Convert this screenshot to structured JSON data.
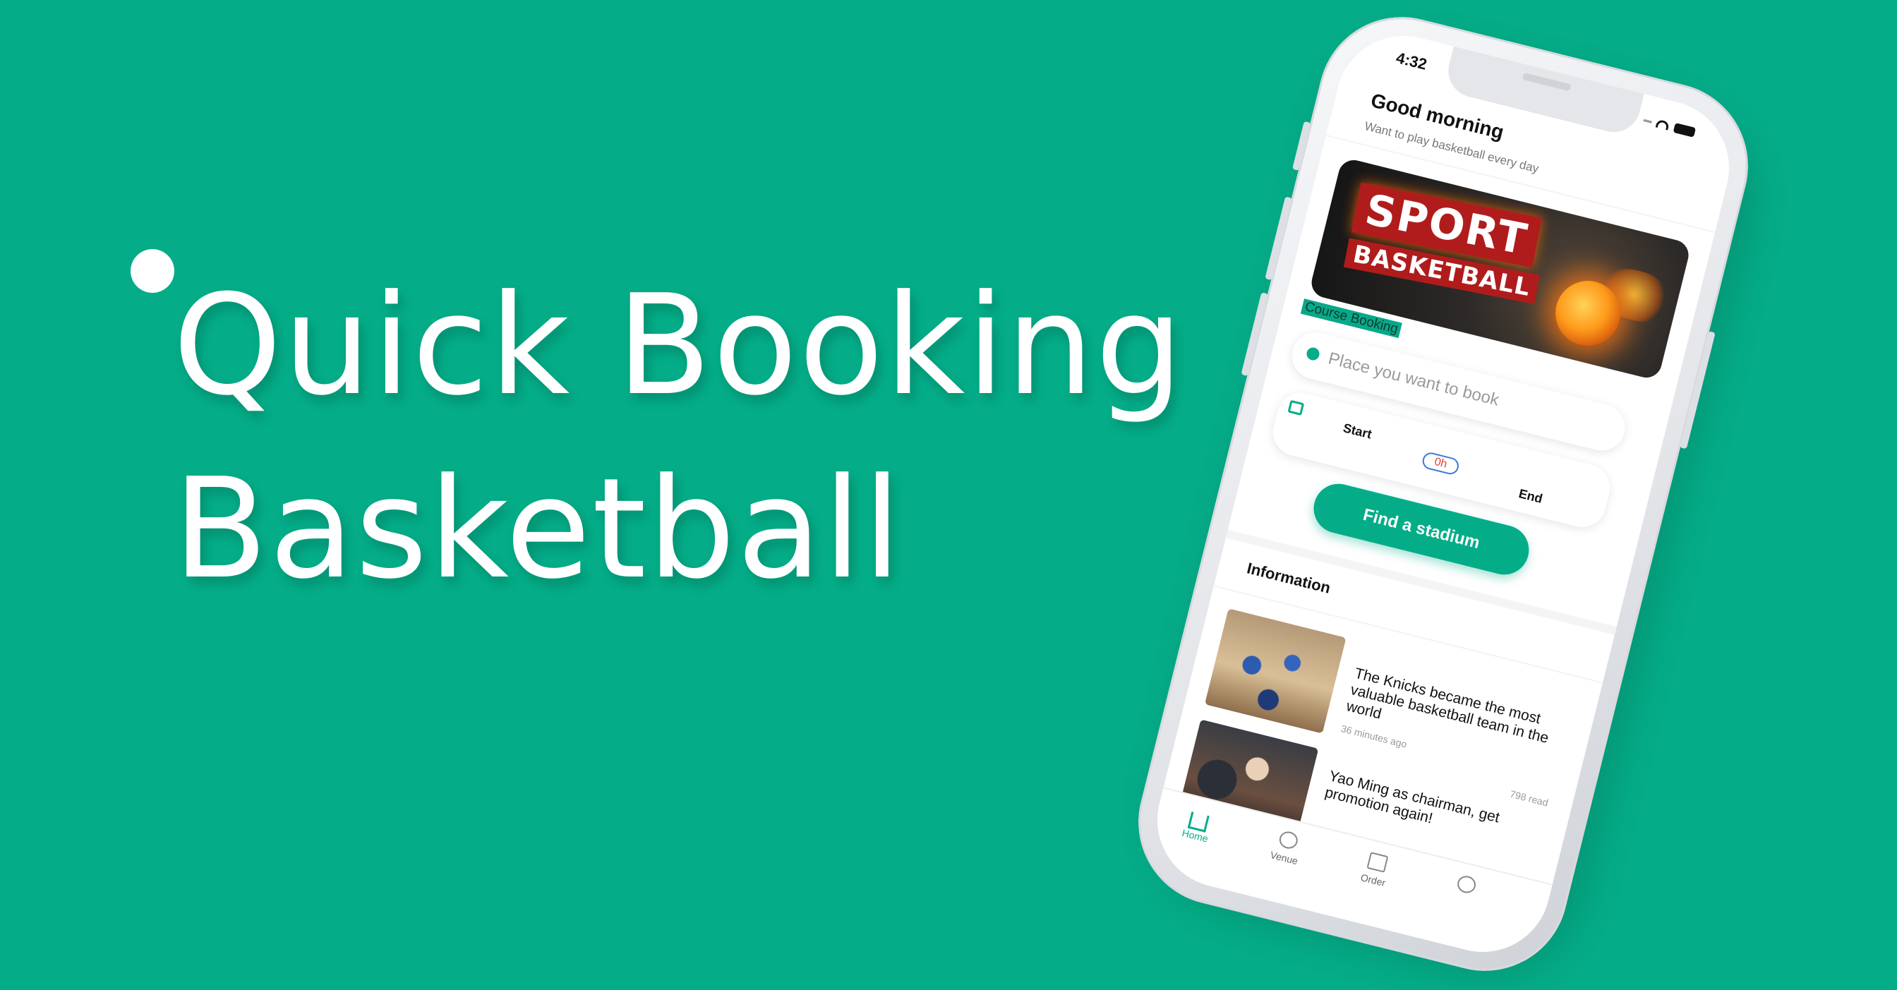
{
  "promo": {
    "line1": "Quick Booking",
    "line2": "Basketball"
  },
  "status_bar": {
    "time": "4:32"
  },
  "header": {
    "greeting": "Good morning",
    "subtitle": "Want to play basketball every day"
  },
  "banner": {
    "line1": "SPORT",
    "line2": "BASKETBALL"
  },
  "booking": {
    "section_label": "Course Booking",
    "place_placeholder": "Place you want to book",
    "start_label": "Start",
    "duration": "0h",
    "end_label": "End",
    "find_button": "Find a stadium"
  },
  "information": {
    "title": "Information",
    "items": [
      {
        "title": "The Knicks became the most valuable basketball team in the world",
        "time": "36 minutes ago",
        "reads": "798 read"
      },
      {
        "title": "Yao Ming as chairman, get promotion again!"
      }
    ]
  },
  "tabbar": {
    "items": [
      {
        "label": "Home",
        "icon": "home-icon",
        "active": true
      },
      {
        "label": "Venue",
        "icon": "basketball-icon",
        "active": false
      },
      {
        "label": "Order",
        "icon": "order-icon",
        "active": false
      },
      {
        "label": "",
        "icon": "user-icon",
        "active": false
      }
    ]
  },
  "colors": {
    "background": "#04ad88",
    "accent": "#04ad88",
    "duration_text": "#e0413c"
  }
}
